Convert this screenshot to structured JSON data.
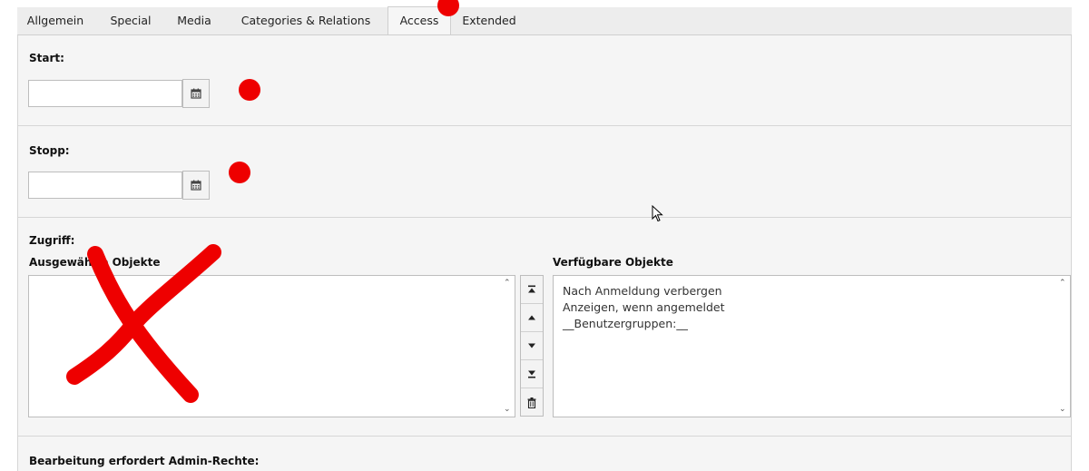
{
  "tabs": [
    {
      "label": "Allgemein"
    },
    {
      "label": "Special"
    },
    {
      "label": "Media"
    },
    {
      "label": "Categories & Relations"
    },
    {
      "label": "Access"
    },
    {
      "label": "Extended"
    }
  ],
  "active_tab": "Access",
  "start": {
    "label": "Start:",
    "value": ""
  },
  "stopp": {
    "label": "Stopp:",
    "value": ""
  },
  "zugriff": {
    "label": "Zugriff:",
    "selected_label": "Ausgewählte Objekte",
    "available_label": "Verfügbare Objekte",
    "selected_items": [],
    "available_items": [
      "Nach Anmeldung verbergen",
      "Anzeigen, wenn angemeldet",
      "__Benutzergruppen:__"
    ]
  },
  "next_field": {
    "label": "Bearbeitung erfordert Admin-Rechte:"
  },
  "icons": {
    "calendar": "calendar-icon",
    "move_top": "move-top-icon",
    "move_up": "move-up-icon",
    "move_down": "move-down-icon",
    "move_bottom": "move-bottom-icon",
    "delete": "trash-icon"
  },
  "annotation_color": "#ee0000"
}
